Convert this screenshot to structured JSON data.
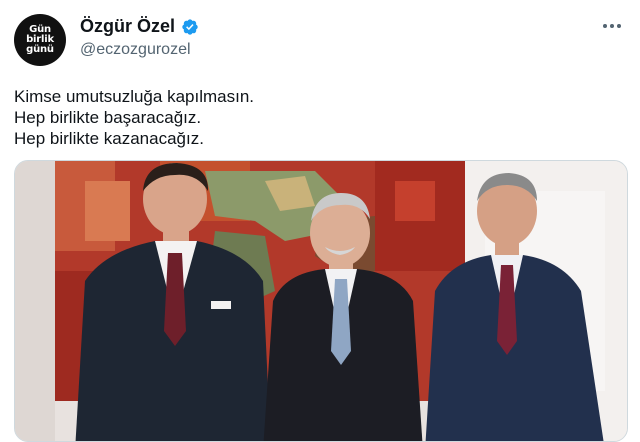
{
  "avatar": {
    "lines": [
      "Gün",
      "birlik",
      "günü"
    ]
  },
  "user": {
    "display_name": "Özgür Özel",
    "handle": "@eczozgurozel"
  },
  "tweet": {
    "lines": [
      "Kimse umutsuzluğa kapılmasın.",
      "Hep birlikte başaracağız.",
      "Hep birlikte kazanacağız."
    ]
  },
  "icons": {
    "verified": "verified-badge-icon",
    "more": "more-horizontal-icon"
  },
  "colors": {
    "verified": "#1d9bf0",
    "handle": "#536471",
    "text": "#0f1419"
  }
}
